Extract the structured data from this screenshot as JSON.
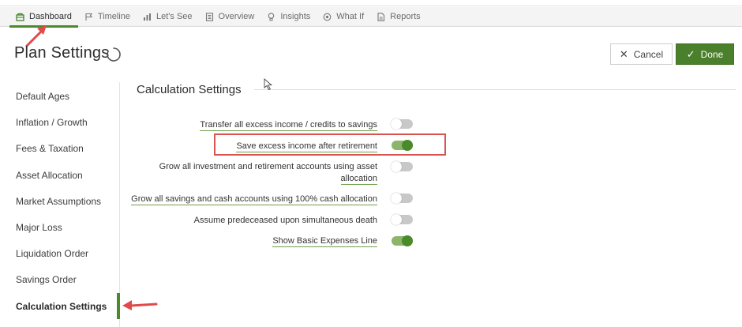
{
  "nav": {
    "items": [
      {
        "label": "Dashboard",
        "icon": "dashboard-icon",
        "active": true
      },
      {
        "label": "Timeline",
        "icon": "timeline-flag-icon"
      },
      {
        "label": "Let's See",
        "icon": "bar-chart-icon"
      },
      {
        "label": "Overview",
        "icon": "document-icon"
      },
      {
        "label": "Insights",
        "icon": "lightbulb-icon"
      },
      {
        "label": "What If",
        "icon": "what-if-icon"
      },
      {
        "label": "Reports",
        "icon": "report-icon"
      }
    ]
  },
  "header": {
    "title": "Plan Settings",
    "cancel_label": "Cancel",
    "done_label": "Done"
  },
  "sidebar": {
    "items": [
      {
        "label": "Default Ages"
      },
      {
        "label": "Inflation / Growth"
      },
      {
        "label": "Fees & Taxation"
      },
      {
        "label": "Asset Allocation"
      },
      {
        "label": "Market Assumptions"
      },
      {
        "label": "Major Loss"
      },
      {
        "label": "Liquidation Order"
      },
      {
        "label": "Savings Order"
      },
      {
        "label": "Calculation Settings",
        "active": true
      }
    ]
  },
  "section": {
    "title": "Calculation Settings",
    "settings": [
      {
        "label": "Transfer all excess income / credits to savings",
        "enabled": false
      },
      {
        "label": "Save excess income after retirement",
        "enabled": true
      },
      {
        "label": "Grow all investment and retirement accounts using asset",
        "label_line2": "allocation",
        "enabled": false
      },
      {
        "label": "Grow all savings and cash accounts using 100% cash allocation",
        "enabled": false
      },
      {
        "label": "Assume predeceased upon simultaneous death",
        "enabled": false
      },
      {
        "label": "Show Basic Expenses Line",
        "enabled": true
      }
    ]
  },
  "colors": {
    "accent": "#4a8a2a",
    "done_button": "#4a7f2b",
    "highlight": "#d9534f",
    "annotation_arrow": "#e04a4a"
  }
}
